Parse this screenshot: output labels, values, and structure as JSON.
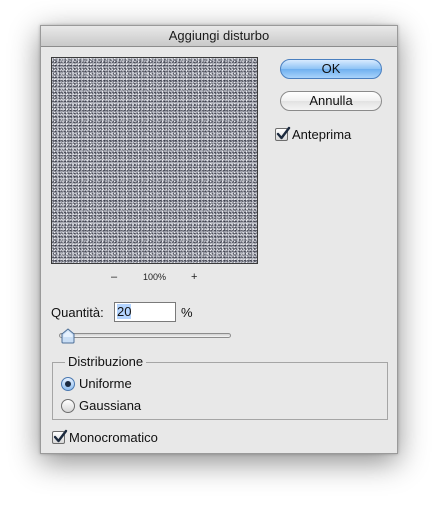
{
  "dialog": {
    "title": "Aggiungi disturbo"
  },
  "preview": {
    "zoom_out_label": "–",
    "zoom_level": "100%",
    "zoom_in_label": "+"
  },
  "buttons": {
    "ok_label": "OK",
    "cancel_label": "Annulla"
  },
  "preview_toggle": {
    "label": "Anteprima",
    "checked": true
  },
  "quantity": {
    "label": "Quantità:",
    "value": "20",
    "unit": "%",
    "slider_value_percent": 20
  },
  "distribution": {
    "title": "Distribuzione",
    "options": [
      {
        "label": "Uniforme",
        "selected": true
      },
      {
        "label": "Gaussiana",
        "selected": false
      }
    ]
  },
  "monochromatic": {
    "label": "Monocromatico",
    "checked": true
  },
  "colors": {
    "ok_button": "#8ec3f5",
    "dialog_bg": "#e8e8e8",
    "selection": "#b5d5ff"
  },
  "icons": {
    "check": "checkmark-icon",
    "slider_thumb": "slider-thumb-icon"
  }
}
